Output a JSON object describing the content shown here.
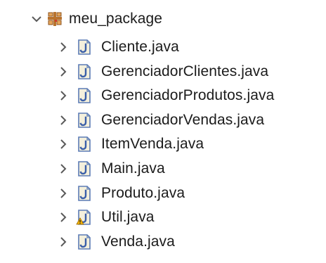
{
  "package": {
    "name": "meu_package",
    "expanded": true,
    "icon": "package-icon"
  },
  "files": [
    {
      "name": "Cliente.java",
      "icon": "java-file-icon",
      "warning": false
    },
    {
      "name": "GerenciadorClientes.java",
      "icon": "java-file-icon",
      "warning": false
    },
    {
      "name": "GerenciadorProdutos.java",
      "icon": "java-file-icon",
      "warning": false
    },
    {
      "name": "GerenciadorVendas.java",
      "icon": "java-file-icon",
      "warning": false
    },
    {
      "name": "ItemVenda.java",
      "icon": "java-file-icon",
      "warning": false
    },
    {
      "name": "Main.java",
      "icon": "java-file-icon",
      "warning": false
    },
    {
      "name": "Produto.java",
      "icon": "java-file-icon",
      "warning": false
    },
    {
      "name": "Util.java",
      "icon": "java-file-warning-icon",
      "warning": true
    },
    {
      "name": "Venda.java",
      "icon": "java-file-icon",
      "warning": false
    }
  ],
  "colors": {
    "chevron": "#5a5a5a",
    "java_icon_border": "#5b7bb5",
    "java_icon_letter": "#3b5fa8",
    "java_icon_fill": "#f4f0dc",
    "warning": "#f5b400",
    "package_brown": "#b8732e",
    "package_red": "#d23a2a"
  }
}
